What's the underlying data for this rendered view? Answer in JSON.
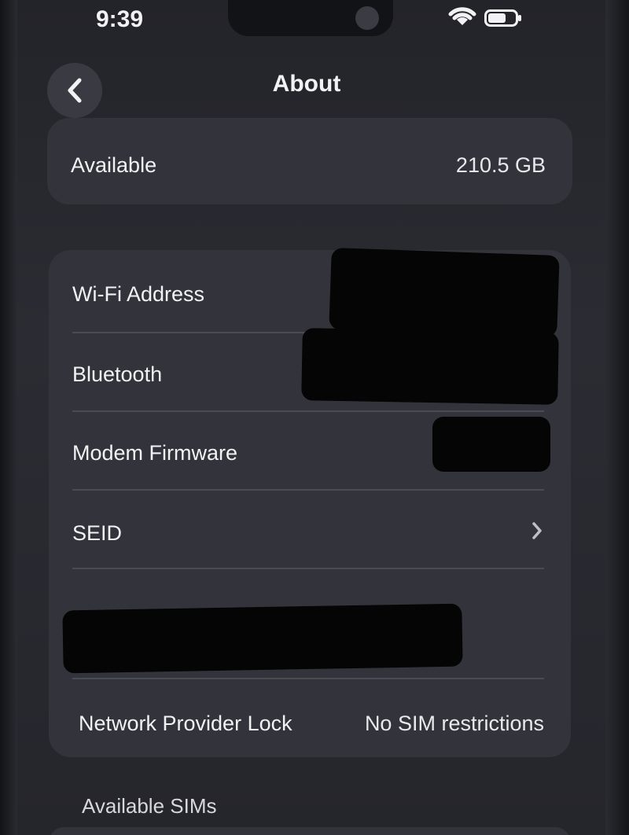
{
  "status": {
    "time": "9:39"
  },
  "nav": {
    "title": "About"
  },
  "storage": {
    "label": "Available",
    "value": "210.5 GB"
  },
  "rows": [
    {
      "label": "Wi-Fi Address",
      "value": ""
    },
    {
      "label": "Bluetooth",
      "value": ""
    },
    {
      "label": "Modem Firmware",
      "value": ""
    },
    {
      "label": "SEID",
      "value": ""
    },
    {
      "label": "",
      "value": ""
    },
    {
      "label": "Network Provider Lock",
      "value": "No SIM restrictions"
    }
  ],
  "sections": {
    "sims_header": "Available SIMs"
  },
  "icons": {
    "back": "chevron-left-icon",
    "seid_chevron": "chevron-right-icon",
    "wifi": "wifi-icon",
    "battery": "battery-icon"
  },
  "colors": {
    "background": "#2a2b31",
    "card": "#33343b",
    "text": "#f2f2f4"
  }
}
